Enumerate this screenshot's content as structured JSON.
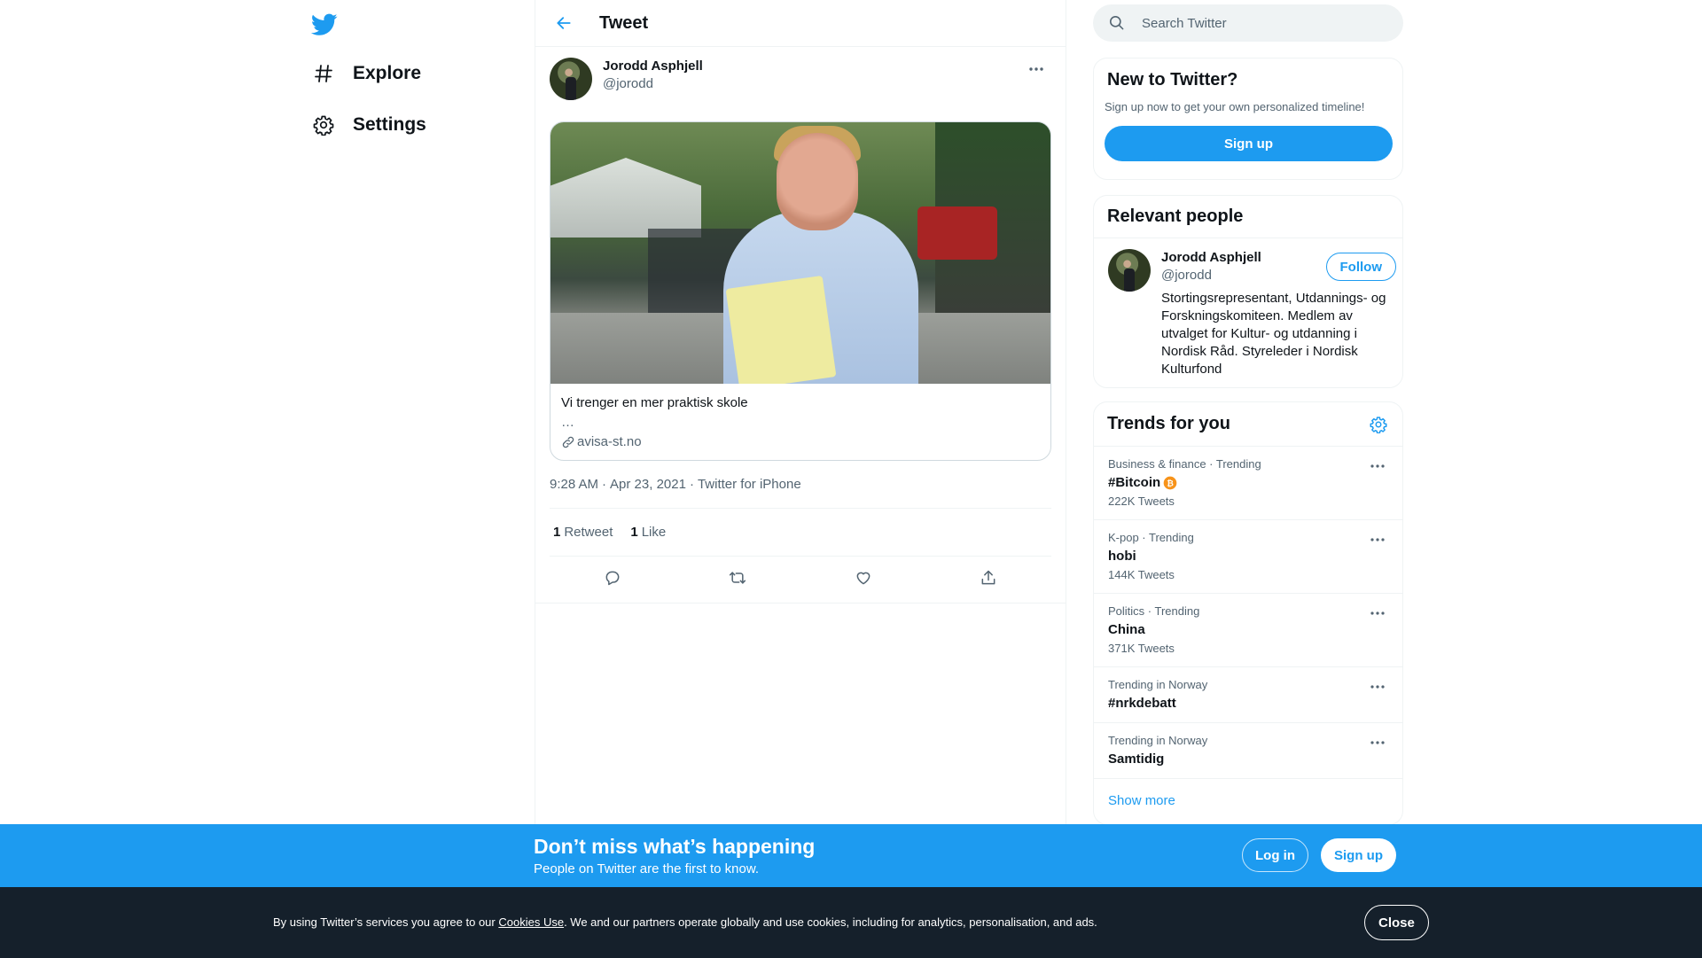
{
  "nav": {
    "items": [
      {
        "label": "Explore",
        "icon": "hashtag-icon"
      },
      {
        "label": "Settings",
        "icon": "gear-icon"
      }
    ]
  },
  "header": {
    "title": "Tweet"
  },
  "tweet": {
    "author_name": "Jorodd Asphjell",
    "author_handle": "@jorodd",
    "card": {
      "title": "Vi trenger en mer praktisk skole",
      "description": "…",
      "domain": "avisa-st.no"
    },
    "time": "9:28 AM",
    "date": "Apr 23, 2021",
    "source": "Twitter for iPhone",
    "retweets": "1",
    "retweets_label": "Retweet",
    "likes": "1",
    "likes_label": "Like"
  },
  "search": {
    "placeholder": "Search Twitter"
  },
  "new_to_twitter": {
    "title": "New to Twitter?",
    "subtitle": "Sign up now to get your own personalized timeline!",
    "button": "Sign up"
  },
  "relevant_people": {
    "title": "Relevant people",
    "name": "Jorodd Asphjell",
    "handle": "@jorodd",
    "follow": "Follow",
    "bio": "Stortingsrepresentant, Utdannings- og Forskningskomiteen. Medlem av utvalget for Kultur- og utdanning i Nordisk Råd. Styreleder i Nordisk Kulturfond"
  },
  "trends": {
    "title": "Trends for you",
    "items": [
      {
        "context": "Business & finance · Trending",
        "name": "#Bitcoin",
        "count": "222K Tweets"
      },
      {
        "context": "K-pop · Trending",
        "name": "hobi",
        "count": "144K Tweets"
      },
      {
        "context": "Politics · Trending",
        "name": "China",
        "count": "371K Tweets"
      },
      {
        "context": "Trending in Norway",
        "name": "#nrkdebatt",
        "count": ""
      },
      {
        "context": "Trending in Norway",
        "name": "Samtidig",
        "count": ""
      }
    ],
    "show_more": "Show more"
  },
  "signup_bar": {
    "title": "Don’t miss what’s happening",
    "subtitle": "People on Twitter are the first to know.",
    "login": "Log in",
    "signup": "Sign up"
  },
  "cookie": {
    "prefix": "By using Twitter’s services you agree to our ",
    "link": "Cookies Use",
    "suffix": ". We and our partners operate globally and use cookies, including for analytics, personalisation, and ads.",
    "close": "Close"
  },
  "colors": {
    "accent": "#1d9bf0",
    "text": "#0f1419",
    "secondary": "#536471",
    "cookie_bg": "#15202b",
    "bitcoin": "#f7931a"
  }
}
